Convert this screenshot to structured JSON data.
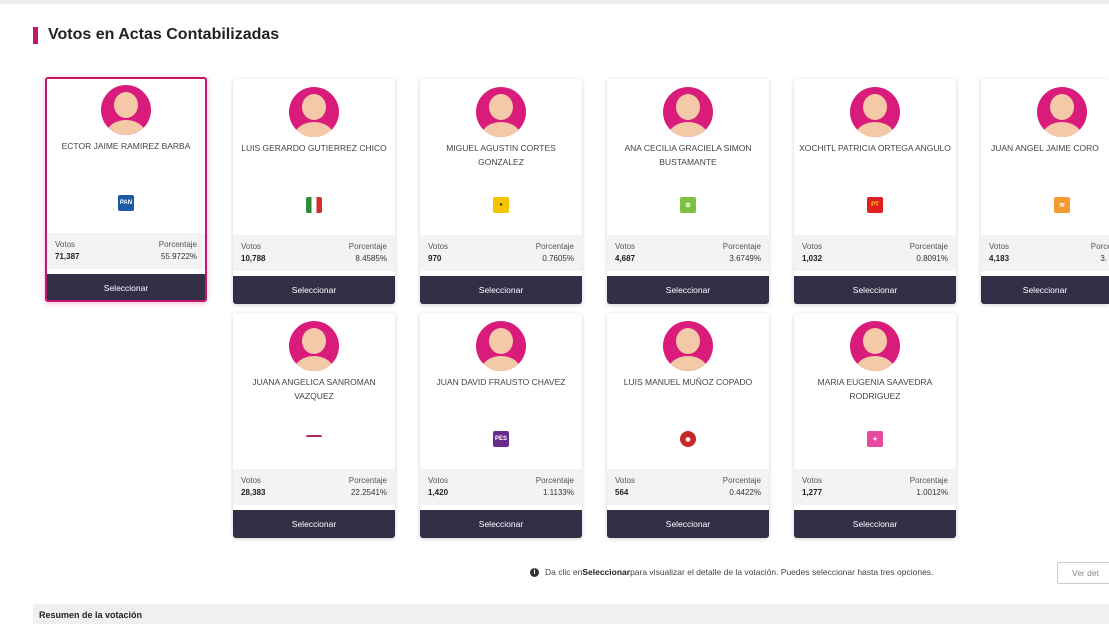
{
  "section_title": "Votos en Actas Contabilizadas",
  "labels": {
    "votos": "Votos",
    "porcentaje": "Porcentaje",
    "button": "Seleccionar"
  },
  "candidates": [
    {
      "name": "ECTOR JAIME RAMIREZ BARBA",
      "party_icon": "pan-logo-icon",
      "party_color": "#1f5aa6",
      "votes": "71,387",
      "percent": "55.9722%",
      "selected": true
    },
    {
      "name": "LUIS GERARDO GUTIERREZ CHICO",
      "party_icon": "pri-logo-icon",
      "party_color": "#2e8b3a",
      "votes": "10,788",
      "percent": "8.4585%",
      "selected": false
    },
    {
      "name": "MIGUEL AGUSTIN CORTES GONZALEZ",
      "party_icon": "prd-logo-icon",
      "party_color": "#f5c400",
      "votes": "970",
      "percent": "0.7605%",
      "selected": false
    },
    {
      "name": "ANA CECILIA GRACIELA SIMON BUSTAMANTE",
      "party_icon": "pvem-logo-icon",
      "party_color": "#7cc242",
      "votes": "4,687",
      "percent": "3.6749%",
      "selected": false
    },
    {
      "name": "XOCHITL PATRICIA ORTEGA ANGULO",
      "party_icon": "pt-logo-icon",
      "party_color": "#e02020",
      "votes": "1,032",
      "percent": "0.8091%",
      "selected": false
    },
    {
      "name": "JUAN ANGEL JAIME CORO",
      "party_icon": "mc-logo-icon",
      "party_color": "#f39a32",
      "votes": "4,183",
      "percent": "3.",
      "selected": false
    },
    {
      "name": "JUANA ANGELICA SANROMAN VAZQUEZ",
      "party_icon": "morena-logo-icon",
      "party_color": "#b5264c",
      "votes": "28,383",
      "percent": "22.2541%",
      "selected": false
    },
    {
      "name": "JUAN DAVID FRAUSTO CHAVEZ",
      "party_icon": "pes-logo-icon",
      "party_color": "#6a2a8c",
      "votes": "1,420",
      "percent": "1.1133%",
      "selected": false
    },
    {
      "name": "LUIS MANUEL MUÑOZ COPADO",
      "party_icon": "rsp-logo-icon",
      "party_color": "#c62828",
      "votes": "564",
      "percent": "0.4422%",
      "selected": false
    },
    {
      "name": "MARIA EUGENIA SAAVEDRA RODRIGUEZ",
      "party_icon": "fxm-logo-icon",
      "party_color": "#e84aa0",
      "votes": "1,277",
      "percent": "1.0012%",
      "selected": false
    }
  ],
  "party_abbr": {
    "pan": "PAN",
    "pri": "PRI",
    "prd": "PRD",
    "pt": "PT",
    "pes": "PES"
  },
  "info": {
    "pre": "Da clic en ",
    "bold": "Seleccionar",
    "post": " para visualizar el detalle de la votación. Puedes seleccionar hasta tres opciones."
  },
  "ver_button": "Ver det",
  "summary_title": "Resumen de la votación"
}
